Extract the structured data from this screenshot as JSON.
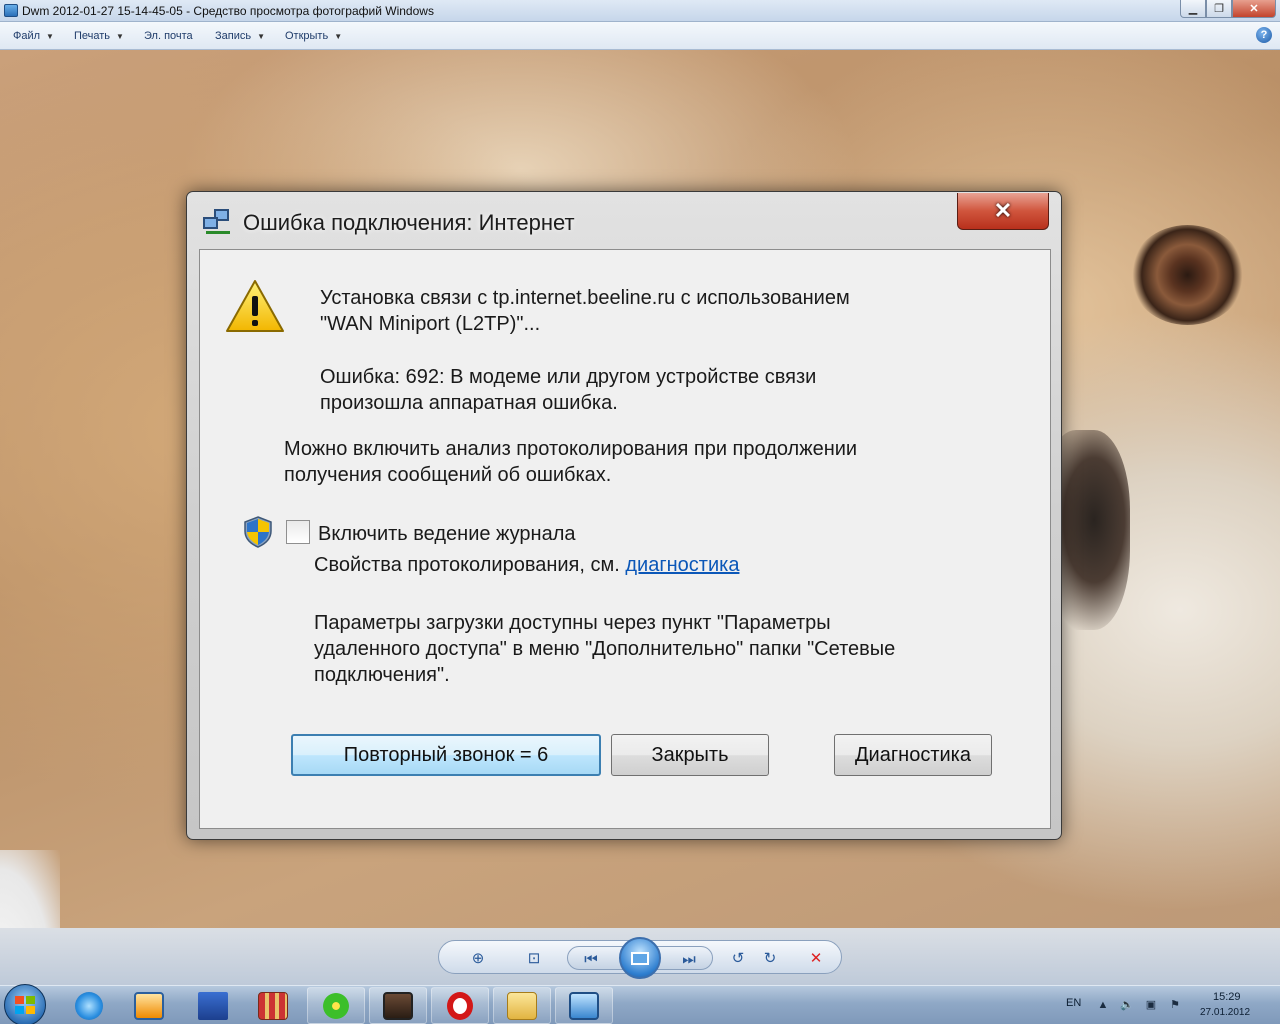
{
  "window": {
    "title": "Dwm 2012-01-27 15-14-45-05 - Средство просмотра фотографий Windows",
    "help_label": "?"
  },
  "menu": {
    "items": [
      {
        "label": "Файл",
        "has_dropdown": true
      },
      {
        "label": "Печать",
        "has_dropdown": true
      },
      {
        "label": "Эл. почта",
        "has_dropdown": false
      },
      {
        "label": "Запись",
        "has_dropdown": true
      },
      {
        "label": "Открыть",
        "has_dropdown": true
      }
    ]
  },
  "dialog": {
    "title": "Ошибка подключения: Интернет",
    "close_label": "✕",
    "message_line1": "Установка связи с tp.internet.beeline.ru с использованием",
    "message_line2": "\"WAN Miniport (L2TP)\"...",
    "error_line1": "Ошибка: 692: В модеме или другом устройстве связи",
    "error_line2": "произошла аппаратная ошибка.",
    "logging_hint_line1": "Можно включить анализ протоколирования при продолжении",
    "logging_hint_line2": "получения сообщений об ошибках.",
    "checkbox_label": "Включить ведение журнала",
    "checkbox_checked": false,
    "properties_text": "Свойства протоколирования, см.",
    "diagnostics_link": "диагностика",
    "params_line1": "Параметры загрузки доступны через пункт \"Параметры",
    "params_line2": "удаленного доступа\" в меню \"Дополнительно\" папки \"Сетевые",
    "params_line3": "подключения\".",
    "buttons": {
      "redial": "Повторный звонок = 6",
      "close": "Закрыть",
      "diagnostics": "Диагностика"
    }
  },
  "taskbar": {
    "language": "EN",
    "time": "15:29",
    "date": "27.01.2012",
    "apps": [
      "internet-explorer",
      "media-player",
      "floppy-save",
      "archiver",
      "icq",
      "avatar-app",
      "opera",
      "file-explorer",
      "photo-viewer"
    ]
  },
  "colors": {
    "link": "#0b57b8",
    "dialog_close": "#c8432c",
    "default_button_border": "#3c7fb1"
  }
}
